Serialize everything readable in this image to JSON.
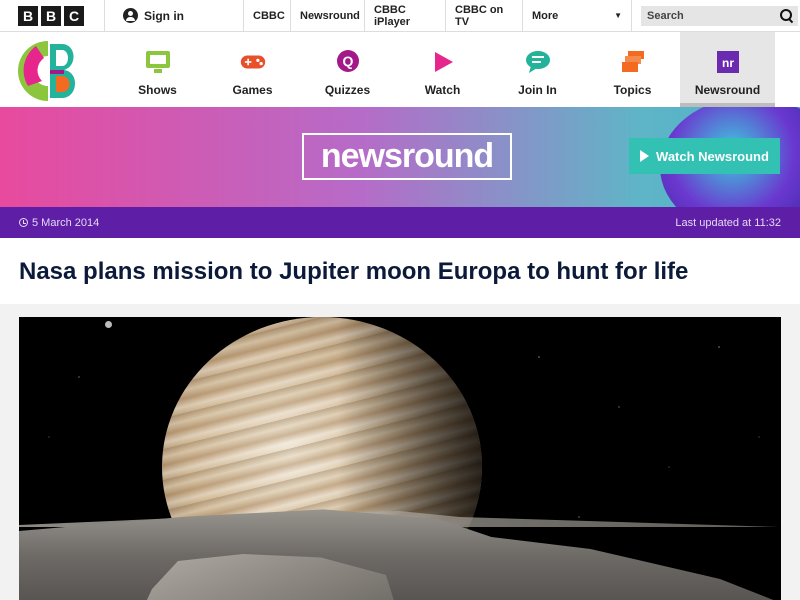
{
  "bbc_bar": {
    "logo_letters": [
      "B",
      "B",
      "C"
    ],
    "signin_label": "Sign in",
    "links": [
      "CBBC",
      "Newsround",
      "CBBC iPlayer",
      "CBBC on TV"
    ],
    "more_label": "More",
    "search_placeholder": "Search"
  },
  "cbbc_nav": {
    "items": [
      {
        "label": "Shows",
        "icon": "tv-icon",
        "color": "#8cc63f"
      },
      {
        "label": "Games",
        "icon": "gamepad-icon",
        "color": "#e8502a"
      },
      {
        "label": "Quizzes",
        "icon": "quiz-icon",
        "color": "#a3198a"
      },
      {
        "label": "Watch",
        "icon": "play-icon",
        "color": "#e6268c"
      },
      {
        "label": "Join In",
        "icon": "chat-icon",
        "color": "#23b29a"
      },
      {
        "label": "Topics",
        "icon": "stack-icon",
        "color": "#f26b21"
      },
      {
        "label": "Newsround",
        "icon": "newsround-icon",
        "color": "#6a2bb0",
        "active": true
      }
    ]
  },
  "banner": {
    "logo_text": "newsround",
    "watch_button": "Watch Newsround"
  },
  "date_bar": {
    "date": "5 March 2014",
    "updated": "Last updated at 11:32"
  },
  "article": {
    "headline": "Nasa plans mission to Jupiter moon Europa to hunt for life"
  },
  "colors": {
    "date_bar": "#5e1fa6",
    "watch_button": "#33c1b4",
    "headline": "#0c1a3a"
  }
}
